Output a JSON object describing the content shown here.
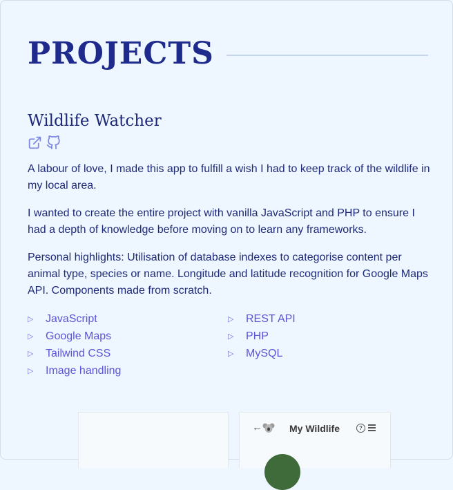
{
  "section": {
    "title": "PROJECTS"
  },
  "project": {
    "name": "Wildlife Watcher",
    "links": [
      {
        "icon": "external-link-icon",
        "label": "Live site"
      },
      {
        "icon": "github-icon",
        "label": "GitHub repository"
      }
    ],
    "paragraphs": [
      "A labour of love, I made this app to fulfill a wish I had to keep track of the wildlife in my local area.",
      "I wanted to create the entire project with vanilla JavaScript and PHP to ensure I had a depth of knowledge before moving on to learn any frameworks.",
      "Personal highlights: Utilisation of database indexes to categorise content per animal type, species or name. Longitude and latitude recognition for Google Maps API. Components made from scratch."
    ],
    "tech_left": [
      "JavaScript",
      "Google Maps",
      "Tailwind CSS",
      "Image handling"
    ],
    "tech_right": [
      "REST API",
      "PHP",
      "MySQL"
    ],
    "bullet_glyph": "▷"
  },
  "preview": {
    "app_title": "My Wildlife",
    "back_glyph": "←",
    "help_glyph": "?"
  },
  "colors": {
    "background": "#eef6ff",
    "heading": "#1e2a8c",
    "text": "#1e2a78",
    "accent": "#5b55d6",
    "rule": "#c6d6ee"
  }
}
